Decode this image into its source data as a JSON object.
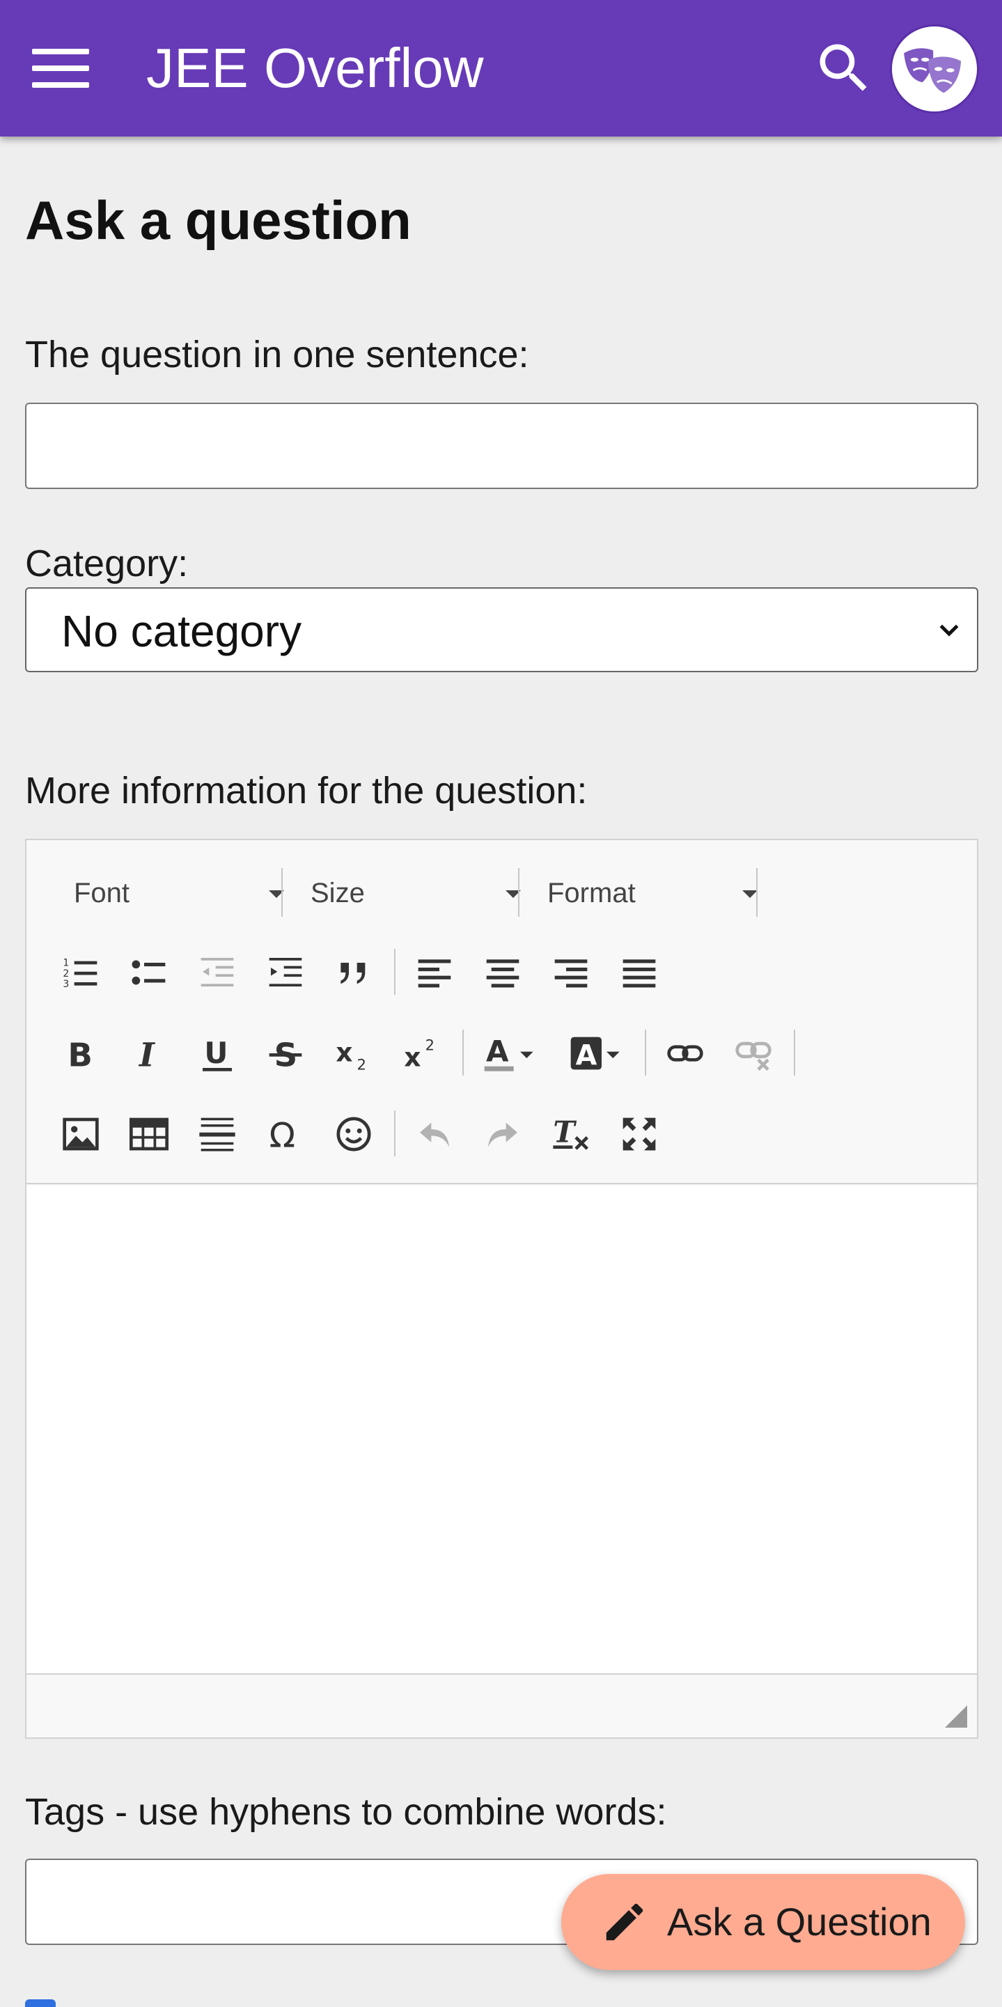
{
  "header": {
    "app_title": "JEE Overflow",
    "menu_icon": "menu-icon",
    "search_icon": "search-icon",
    "avatar_icon": "theater-masks-avatar",
    "color": "#673ab7"
  },
  "page": {
    "title": "Ask a question"
  },
  "form": {
    "question_label": "The question in one sentence:",
    "question_value": "",
    "category_label": "Category:",
    "category_selected": "No category",
    "more_info_label": "More information for the question:",
    "tags_label": "Tags - use hyphens to combine words:",
    "tags_value": ""
  },
  "editor": {
    "font_combo": "Font",
    "size_combo": "Size",
    "format_combo": "Format",
    "toolbar_icons": [
      "numbered-list-icon",
      "bulleted-list-icon",
      "decrease-indent-icon",
      "increase-indent-icon",
      "blockquote-icon",
      "align-left-icon",
      "align-center-icon",
      "align-right-icon",
      "justify-icon",
      "bold-icon",
      "italic-icon",
      "underline-icon",
      "strikethrough-icon",
      "subscript-icon",
      "superscript-icon",
      "text-color-icon",
      "background-color-icon",
      "link-icon",
      "unlink-icon",
      "image-icon",
      "table-icon",
      "horizontal-line-icon",
      "special-character-icon",
      "emoji-icon",
      "undo-icon",
      "redo-icon",
      "remove-format-icon",
      "maximize-icon"
    ]
  },
  "fab": {
    "label": "Ask a Question",
    "icon": "pencil-icon",
    "color": "#ffab91"
  }
}
